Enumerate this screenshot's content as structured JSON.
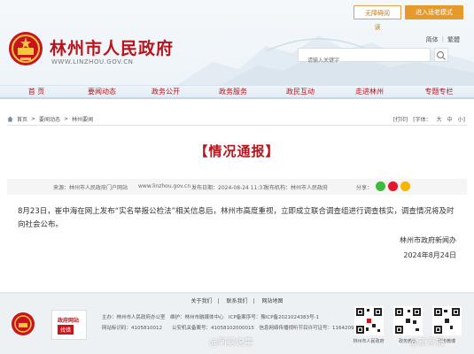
{
  "top_util": {
    "accessible": "无障碍阅读",
    "elder_mode": "进入适老模式"
  },
  "header": {
    "title": "林州市人民政府",
    "domain": "WWW.LINZHOU.GOV.CN",
    "lang_simplified": "简体",
    "lang_sep": "|",
    "lang_traditional": "繁體",
    "search_placeholder": "请输入关键字"
  },
  "nav": {
    "items": [
      {
        "label": "首 页"
      },
      {
        "label": "要闻动态"
      },
      {
        "label": "政务公开"
      },
      {
        "label": "政务服务"
      },
      {
        "label": "政民互动"
      },
      {
        "label": "走进林州"
      },
      {
        "label": "专题专栏"
      }
    ]
  },
  "breadcrumb": {
    "home": "首页",
    "sep1": ">",
    "section": "要闻动态",
    "sep2": ">",
    "current": "林州要闻"
  },
  "tools": {
    "print": "[打印]",
    "font": "[字体：",
    "large": "大",
    "medium": "中",
    "small": "小]"
  },
  "article": {
    "title": "【情况通报】",
    "source": "来源：林州市人民政府门户网站",
    "url": "www.linzhou.gov.cn",
    "time": "发布日期：2024-08-24 11:37",
    "author": "发布机构：林州市人民政府",
    "share": "分享：",
    "paragraph": "8月23日，崔中海在网上发布“实名举报公检法”相关信息后，林州市高度重视，立即成立联合调查组进行调查核实，调查情况将及时向社会公布。",
    "sign_org": "林州市政府新闻办",
    "sign_date": "2024年8月24日"
  },
  "footer": {
    "links": [
      "关于我们",
      "联系我们",
      "网站地图"
    ],
    "line1": "主办：林州市人民政府办公室　维护：林州市融媒体中心　ICP备案序号：豫ICP备2021024383号-1",
    "line2": "网站标识码：4105810012　　公安机关备案号：41058102000015　信息网络传播视听节目许可证号：1164209",
    "correct_label": "政府网站",
    "correct_sub": "找错",
    "qr1_label": "林州市人民政府",
    "qr2_label": "政务微信",
    "qr3_label": "政务微博"
  },
  "watermark": {
    "left": "@阿雾说事",
    "right": "@新京报"
  },
  "colors": {
    "brand_red": "#b5151b",
    "accent_orange": "#e79a2c"
  }
}
